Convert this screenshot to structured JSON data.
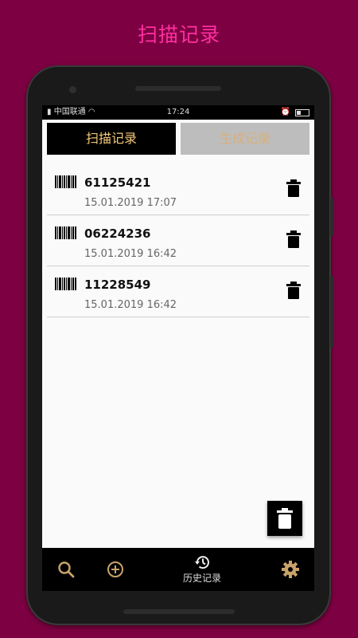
{
  "banner_title": "扫描记录",
  "status_bar": {
    "carrier": "中国联通",
    "time": "17:24"
  },
  "tabs": [
    {
      "label": "扫描记录",
      "active": true
    },
    {
      "label": "生成记录",
      "active": false
    }
  ],
  "records": [
    {
      "code": "61125421",
      "date": "15.01.2019 17:07"
    },
    {
      "code": "06224236",
      "date": "15.01.2019 16:42"
    },
    {
      "code": "11228549",
      "date": "15.01.2019 16:42"
    }
  ],
  "bottom_nav": {
    "search_icon": "search-icon",
    "add_icon": "add-circle-icon",
    "history_label": "历史记录",
    "settings_icon": "gear-icon"
  },
  "colors": {
    "background": "#7d0042",
    "headline": "#ff2fa0",
    "accent": "#f5c77a",
    "nav_icon": "#c9a36a"
  }
}
